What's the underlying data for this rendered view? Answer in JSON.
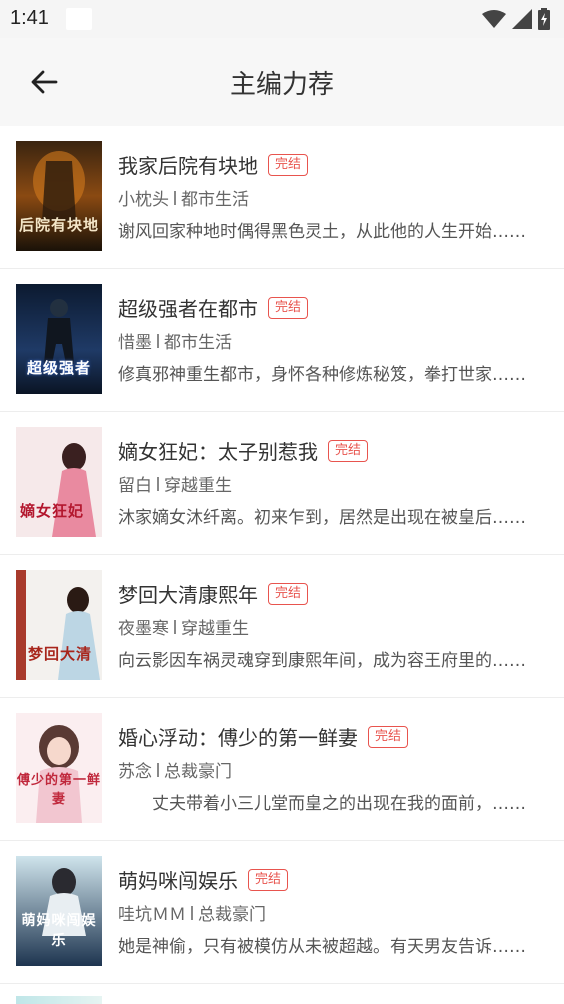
{
  "status_bar": {
    "time": "1:41"
  },
  "app_bar": {
    "title": "主编力荐"
  },
  "badge_label": "完结",
  "books": [
    {
      "title": "我家后院有块地",
      "author": "小枕头",
      "category": "都市生活",
      "description": "谢风回家种地时偶得黑色灵土，从此他的人生开始……",
      "status": "完结",
      "cover_text": "后院有块地"
    },
    {
      "title": "超级强者在都市",
      "author": "惜墨",
      "category": "都市生活",
      "description": "修真邪神重生都市，身怀各种修炼秘笈，拳打世家……",
      "status": "完结",
      "cover_text": "超级强者"
    },
    {
      "title": "嫡女狂妃：太子别惹我",
      "author": "留白",
      "category": "穿越重生",
      "description": "沐家嫡女沐纤离。初来乍到，居然是出现在被皇后……",
      "status": "完结",
      "cover_text": "嫡女狂妃"
    },
    {
      "title": "梦回大清康熙年",
      "author": "夜墨寒",
      "category": "穿越重生",
      "description": "向云影因车祸灵魂穿到康熙年间，成为容王府里的……",
      "status": "完结",
      "cover_text": "梦回大清"
    },
    {
      "title": "婚心浮动：傅少的第一鲜妻",
      "author": "苏念",
      "category": "总裁豪门",
      "description": "　　丈夫带着小三儿堂而皇之的出现在我的面前，……",
      "status": "完结",
      "cover_text": "傅少的第一鲜妻"
    },
    {
      "title": "萌妈咪闯娱乐",
      "author": "哇坑ＭＭ",
      "category": "总裁豪门",
      "description": "她是神偷，只有被模仿从未被超越。有天男友告诉……",
      "status": "完结",
      "cover_text": "萌妈咪闯娱乐"
    }
  ]
}
